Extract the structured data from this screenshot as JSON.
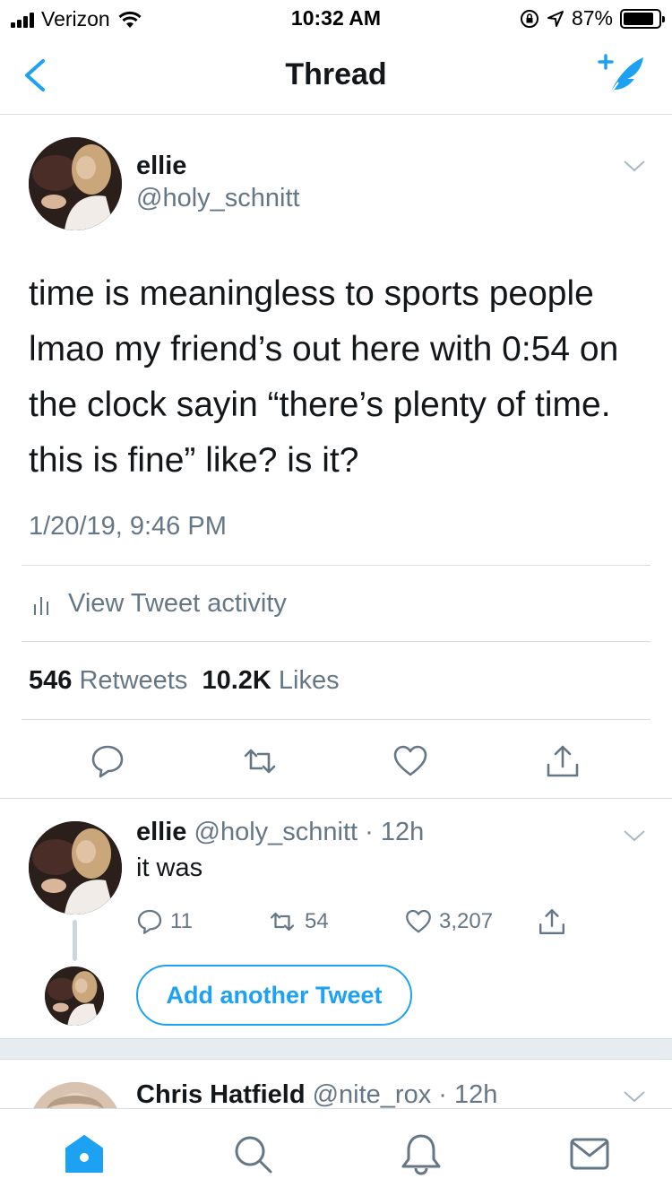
{
  "status_bar": {
    "carrier": "Verizon",
    "time": "10:32 AM",
    "battery": "87%",
    "battery_level": 0.87
  },
  "nav": {
    "title": "Thread",
    "back_icon": "chevron-left-icon",
    "compose_icon": "compose-tweet-icon"
  },
  "main_tweet": {
    "name": "ellie",
    "handle": "@holy_schnitt",
    "text": "time is meaningless to sports people lmao my friend’s out here with 0:54 on the clock sayin “there’s plenty of time. this is fine” like? is it?",
    "timestamp": "1/20/19, 9:46 PM",
    "activity_label": "View Tweet activity",
    "retweets_count": "546",
    "retweets_label": "Retweets",
    "likes_count": "10.2K",
    "likes_label": "Likes"
  },
  "reply_tweet": {
    "name": "ellie",
    "handle": "@holy_schnitt",
    "age": "· 12h",
    "text": "it was",
    "replies": "11",
    "retweets": "54",
    "likes": "3,207"
  },
  "add_tweet_button": "Add another Tweet",
  "third_tweet": {
    "name": "Chris Hatfield",
    "handle": "@nite_rox",
    "age": "· 12h"
  },
  "colors": {
    "accent": "#1da1f2",
    "secondary_text": "#657786",
    "primary_text": "#14171a",
    "divider": "#d6dde3"
  }
}
